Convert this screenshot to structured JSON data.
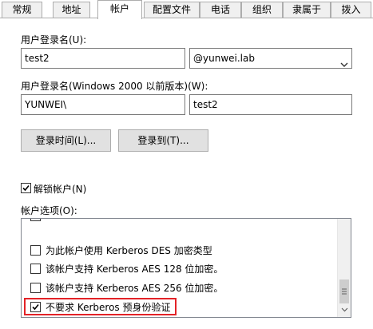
{
  "tabs": [
    {
      "label": "常规",
      "active": false
    },
    {
      "label": "地址",
      "active": false
    },
    {
      "label": "帐户",
      "active": true
    },
    {
      "label": "配置文件",
      "active": false
    },
    {
      "label": "电话",
      "active": false
    },
    {
      "label": "组织",
      "active": false
    },
    {
      "label": "隶属于",
      "active": false
    },
    {
      "label": "拨入",
      "active": false
    }
  ],
  "account": {
    "logon_name_label": "用户登录名(U):",
    "logon_name_value": "test2",
    "domain_suffix_value": "@yunwei.lab",
    "pre2000_label": "用户登录名(Windows 2000 以前版本)(W):",
    "pre2000_domain_value": "YUNWEI\\",
    "pre2000_name_value": "test2",
    "logon_hours_button": "登录时间(L)...",
    "logon_to_button": "登录到(T)...",
    "unlock_label": "解锁帐户(N)",
    "unlock_checked": true,
    "options_label": "帐户选项(O):",
    "options": [
      {
        "label": "为此帐户使用 Kerberos DES 加密类型",
        "checked": false
      },
      {
        "label": "该帐户支持 Kerberos AES 128 位加密。",
        "checked": false
      },
      {
        "label": "该帐户支持 Kerberos AES 256 位加密。",
        "checked": false
      },
      {
        "label": "不要求 Kerberos 预身份验证",
        "checked": true
      }
    ]
  },
  "colors": {
    "highlight": "#e32227",
    "tab_bg": "#f0f0f0",
    "button_bg": "#e1e1e1"
  },
  "icons": {
    "combo_arrow": "chevron-down-icon",
    "check": "checkmark-icon",
    "scroll_thumb_grip": "grip-lines-icon"
  }
}
